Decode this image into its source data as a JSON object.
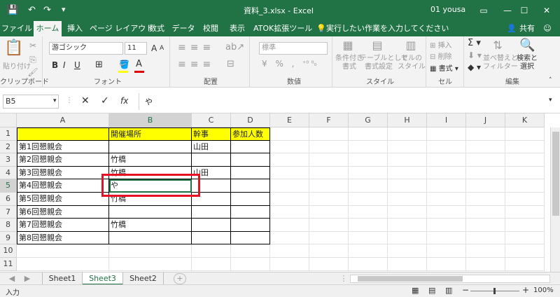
{
  "app": {
    "quick_access": {
      "save_icon": "save-icon",
      "undo_icon": "undo-icon",
      "redo_icon": "redo-icon"
    },
    "title": "資料_3.xlsx  -  Excel",
    "user": "01 yousa",
    "window_buttons": [
      "▭",
      "—",
      "☐",
      "✕"
    ]
  },
  "ribbon_tabs": [
    "ファイル",
    "ホーム",
    "挿入",
    "ページ レイアウト",
    "数式",
    "データ",
    "校閲",
    "表示",
    "ATOK拡張ツール"
  ],
  "active_tab": "ホーム",
  "tell_me": "実行したい作業を入力してください",
  "share": "共有",
  "ribbon": {
    "clipboard": {
      "paste": "貼り付け",
      "label": "クリップボード"
    },
    "font": {
      "name": "游ゴシック",
      "size": "11",
      "bold": "B",
      "italic": "I",
      "underline": "U",
      "grow": "A",
      "shrink": "A",
      "label": "フォント",
      "font_color_letter": "A",
      "font_color": "#e00000",
      "fill_color": "#ffff00"
    },
    "alignment": {
      "label": "配置"
    },
    "number": {
      "format": "標準",
      "label": "数値"
    },
    "styles": {
      "conditional": "条件付き\n書式",
      "table": "テーブルとして\n書式設定",
      "cell_styles": "セルの\nスタイル",
      "label": "スタイル"
    },
    "cells": {
      "insert": "挿入",
      "delete": "削除",
      "format": "書式",
      "label": "セル"
    },
    "editing": {
      "sort": "並べ替えと\nフィルター",
      "find": "検索と\n選択",
      "label": "編集"
    }
  },
  "formula_bar": {
    "name_box": "B5",
    "cancel": "✕",
    "enter": "✓",
    "fx": "fx",
    "content": "や"
  },
  "grid": {
    "columns": [
      "A",
      "B",
      "C",
      "D",
      "E",
      "F",
      "G",
      "H",
      "I",
      "J",
      "K"
    ],
    "rows": [
      "1",
      "2",
      "3",
      "4",
      "5",
      "6",
      "7",
      "8",
      "9",
      "10",
      "11"
    ],
    "header_fill": "#ffff00",
    "cells": {
      "A1": "",
      "B1": "開催場所",
      "C1": "幹事",
      "D1": "参加人数",
      "A2": "第1回懇親会",
      "C2": "山田",
      "A3": "第2回懇親会",
      "B3": "竹橋",
      "A4": "第3回懇親会",
      "B4": "竹橋",
      "C4": "山田",
      "A5": "第4回懇親会",
      "B5": "や",
      "A6": "第5回懇親会",
      "B6": "竹橋",
      "A7": "第6回懇親会",
      "A8": "第7回懇親会",
      "B8": "竹橋",
      "A9": "第8回懇親会"
    },
    "selected_cell": "B5",
    "highlight_color": "#e81123"
  },
  "sheet_tabs": [
    "Sheet1",
    "Sheet3",
    "Sheet2"
  ],
  "active_sheet": "Sheet3",
  "add_sheet": "+",
  "status": {
    "mode": "入力",
    "zoom": "100%",
    "zoom_minus": "−",
    "zoom_plus": "+"
  }
}
